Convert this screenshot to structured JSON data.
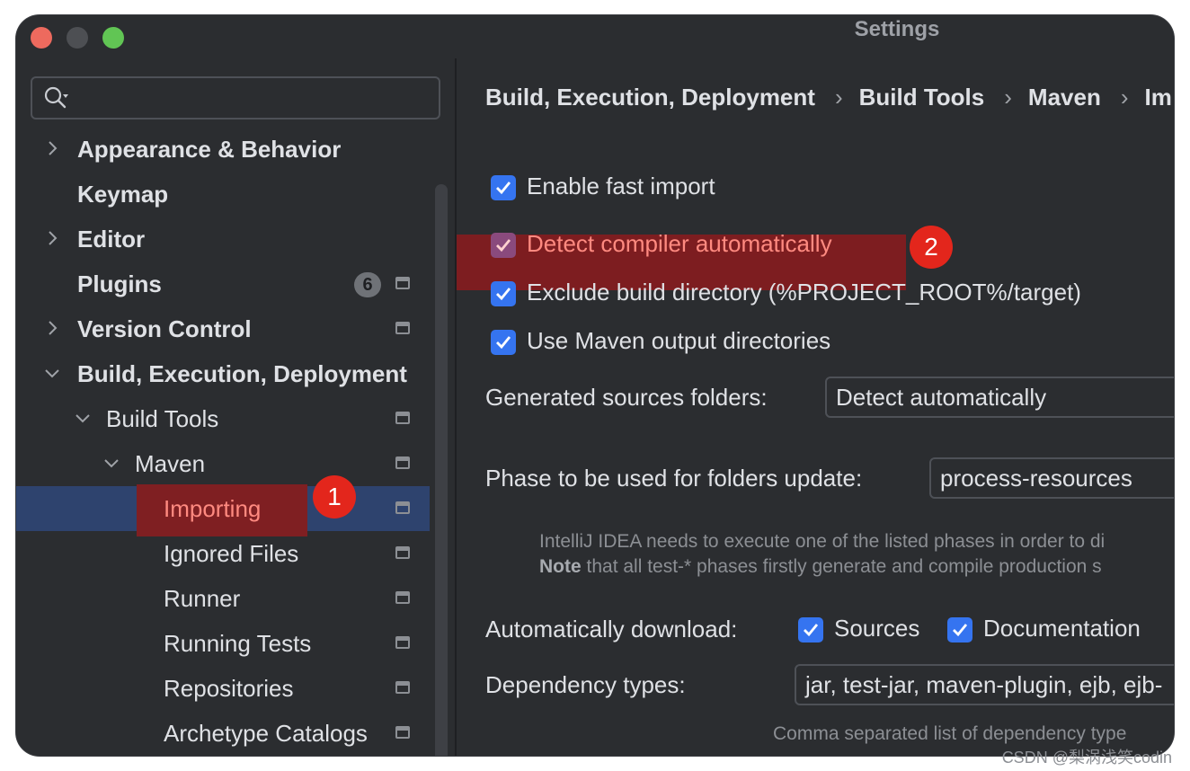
{
  "window": {
    "title": "Settings"
  },
  "sidebar": {
    "search_placeholder": "",
    "items": [
      {
        "label": "Appearance & Behavior"
      },
      {
        "label": "Keymap"
      },
      {
        "label": "Editor"
      },
      {
        "label": "Plugins",
        "badge": "6"
      },
      {
        "label": "Version Control"
      },
      {
        "label": "Build, Execution, Deployment"
      },
      {
        "label": "Build Tools"
      },
      {
        "label": "Maven"
      },
      {
        "label": "Importing"
      },
      {
        "label": "Ignored Files"
      },
      {
        "label": "Runner"
      },
      {
        "label": "Running Tests"
      },
      {
        "label": "Repositories"
      },
      {
        "label": "Archetype Catalogs"
      }
    ]
  },
  "annotations": {
    "one": "1",
    "two": "2"
  },
  "main": {
    "breadcrumb": [
      "Build, Execution, Deployment",
      "Build Tools",
      "Maven",
      "Im"
    ],
    "checkboxes": [
      {
        "label": "Enable fast import",
        "checked": true
      },
      {
        "label": "Detect compiler automatically",
        "checked": true
      },
      {
        "label": "Exclude build directory (%PROJECT_ROOT%/target)",
        "checked": true
      },
      {
        "label": "Use Maven output directories",
        "checked": true
      }
    ],
    "generated_sources": {
      "label": "Generated sources folders:",
      "value": "Detect automatically"
    },
    "phase": {
      "label": "Phase to be used for folders update:",
      "value": "process-resources",
      "hint1": "IntelliJ IDEA needs to execute one of the listed phases in order to di",
      "hint2_bold": "Note",
      "hint2_rest": " that all test-* phases firstly generate and compile production s"
    },
    "auto_download": {
      "label": "Automatically download:",
      "sources": "Sources",
      "documentation": "Documentation"
    },
    "dependency_types": {
      "label": "Dependency types:",
      "value": "jar, test-jar, maven-plugin, ejb, ejb-",
      "hint": "Comma separated list of dependency type"
    }
  },
  "watermark": "CSDN @梨涡浅笑codin"
}
